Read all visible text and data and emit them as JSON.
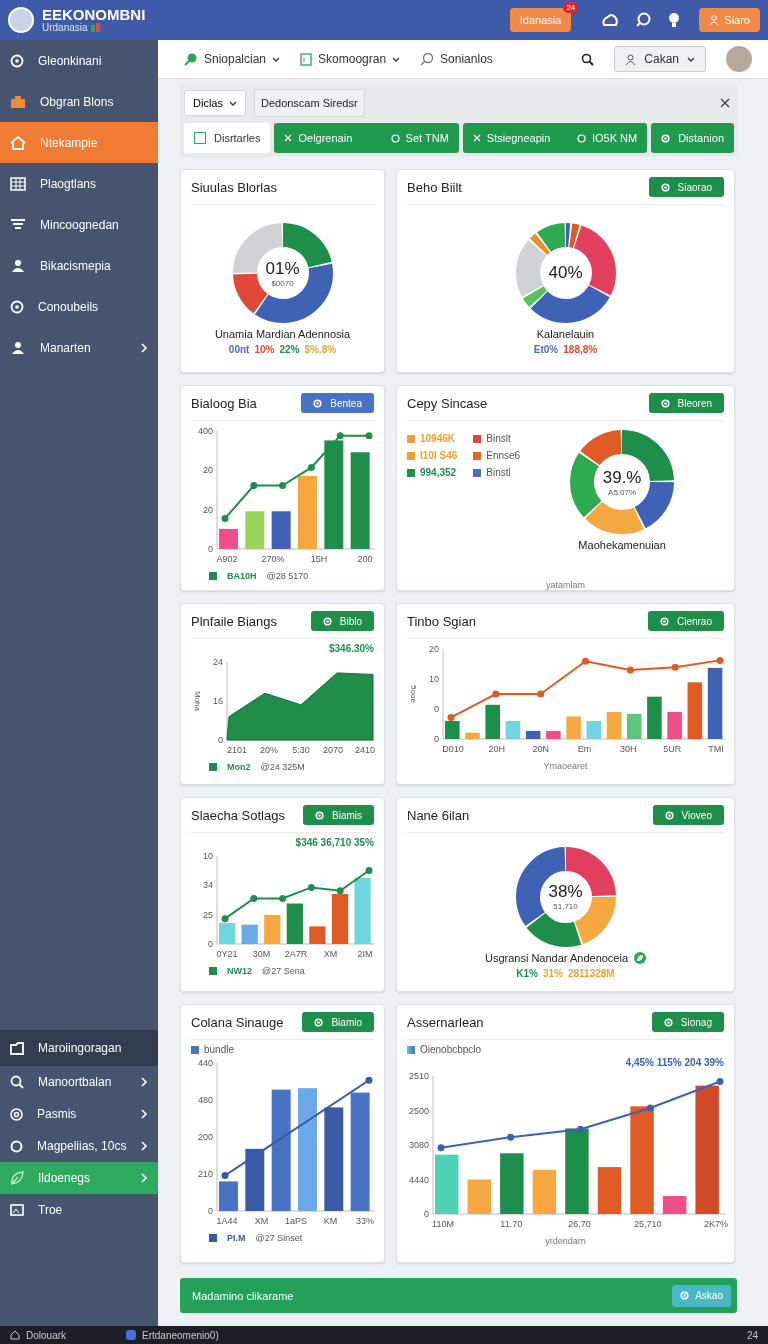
{
  "header": {
    "brand": "EEKONOMBNI",
    "subtitle": "Urdanasia",
    "notify": {
      "label": "Idanasia",
      "badge": "24"
    },
    "action": "Siaro"
  },
  "sidebar": {
    "items": [
      {
        "label": "Gleonkinani",
        "selected": false,
        "chevron": false
      },
      {
        "label": "Obgran Blons",
        "selected": false,
        "chevron": false
      },
      {
        "label": "Ntekampie",
        "selected": true,
        "chevron": false
      },
      {
        "label": "Plaogtlans",
        "selected": false,
        "chevron": false
      },
      {
        "label": "Mincoognedan",
        "selected": false,
        "chevron": false
      },
      {
        "label": "Bikacismepia",
        "selected": false,
        "chevron": false
      },
      {
        "label": "Conoubeils",
        "selected": false,
        "chevron": false
      },
      {
        "label": "Manarten",
        "selected": false,
        "chevron": true
      }
    ],
    "lower_items": [
      {
        "label": "Maroiingoragan",
        "kind": "group",
        "selected": false,
        "chevron": false
      },
      {
        "label": "Manoortbalan",
        "kind": "item",
        "selected": false,
        "chevron": true
      },
      {
        "label": "Pasmis",
        "kind": "item",
        "selected": false,
        "chevron": true
      },
      {
        "label": "Magpeliias, 10cs",
        "kind": "item",
        "selected": false,
        "chevron": true
      },
      {
        "label": "Ildoenegs",
        "kind": "item",
        "selected": true,
        "chevron": true
      },
      {
        "label": "Troe",
        "kind": "item",
        "selected": false,
        "chevron": false
      }
    ]
  },
  "nav": {
    "tabs": [
      {
        "label": "Sniopalcian",
        "dropdown": true
      },
      {
        "label": "Skomoogran",
        "dropdown": true
      },
      {
        "label": "Sonianlos",
        "dropdown": false
      }
    ],
    "account": "Cakan"
  },
  "filter": {
    "dropdown": "Diclas",
    "text": "Dedonscam Siredsr"
  },
  "chips": [
    {
      "label": "Disrtarles",
      "kind": "check"
    },
    {
      "label": "Oelgrenain",
      "kind": "pair",
      "value": "Set TNM"
    },
    {
      "label": "Stsiegneapin",
      "kind": "pair",
      "value": "IO5K NM"
    },
    {
      "label": "Distanion",
      "kind": "single"
    }
  ],
  "cards": [
    {
      "title": "Siuulas Blorlas",
      "kind": "donut",
      "center": "01%",
      "sub": "$0070",
      "caption": "Unamia Mardian Adennosia",
      "legend": [
        {
          "label": "00nt",
          "color": "#4a6fbf"
        },
        {
          "label": "10%",
          "color": "#e0483a"
        },
        {
          "label": "22%",
          "color": "#1e8e4a"
        },
        {
          "label": "$%.8%",
          "color": "#e8a23a"
        }
      ]
    },
    {
      "title": "Beho Biilt",
      "button": {
        "label": "Siaorao",
        "color": "#1e8e4a"
      },
      "kind": "donut",
      "center": "40%",
      "caption": "Kalanelauin",
      "legend": [
        {
          "label": "Et0%",
          "color": "#4a6fbf"
        },
        {
          "label": "188,8%",
          "color": "#e0483a"
        }
      ]
    },
    {
      "title": "Bialoog Bia",
      "button": {
        "label": "Bentea",
        "color": "#4a72c4"
      },
      "kind": "chart",
      "yticks": [
        "400",
        "20",
        "20",
        "0"
      ],
      "xticks": [
        "A902",
        "270%",
        "15H",
        "200"
      ],
      "legend": [
        "BA10H",
        "@28 5170"
      ]
    },
    {
      "title": "Cepy Sincase",
      "button": {
        "label": "Bleoren",
        "color": "#1e8e4a"
      },
      "kind": "legend-donut",
      "keys": [
        {
          "label": "10946K",
          "color": "#f0a030"
        },
        {
          "label": "Binslt",
          "color": "#e0483a"
        },
        {
          "label": "I10I S46",
          "color": "#f0a030"
        },
        {
          "label": "Ennse6",
          "color": "#e06a20"
        },
        {
          "label": "994,352",
          "color": "#1e8e4a"
        },
        {
          "label": "Binstl",
          "color": "#4a6fbf"
        }
      ],
      "center": "39.%",
      "sub": "A5.07%",
      "caption": "Maohekamenuian",
      "note": "yatamlam"
    },
    {
      "title": "Plnfaile Biangs",
      "button": {
        "label": "Biblo",
        "color": "#1e8e4a"
      },
      "kind": "chart",
      "annotation": "$346.30%",
      "ylabel": "Moha",
      "yticks": [
        "24",
        "16",
        "0"
      ],
      "xticks": [
        "2101",
        "20%",
        "5:30",
        "2070",
        "2410"
      ],
      "legend": [
        "Mon2",
        "@24 325M"
      ]
    },
    {
      "title": "Tinbo Sgian",
      "button": {
        "label": "Cienrao",
        "color": "#1e8e4a"
      },
      "kind": "chart",
      "ylabel": "5ooe",
      "yticks": [
        "20",
        "10",
        "0",
        "0"
      ],
      "xticks": [
        "D010",
        "20H",
        "20N",
        "Em",
        "30H",
        "5UR",
        "TMI"
      ],
      "xlabel": "Ymaoearet"
    },
    {
      "title": "Slaecha Sotlags",
      "button": {
        "label": "Biamis",
        "color": "#1e8e4a"
      },
      "kind": "chart",
      "annotation": "$346 36,710 35%",
      "yticks": [
        "10",
        "34",
        "25",
        "0"
      ],
      "xticks": [
        "0Y21",
        "30M",
        "2A7R",
        "XM",
        "2IM"
      ],
      "legend": [
        "NW12",
        "@27 Sena"
      ]
    },
    {
      "title": "Nane 6ilan",
      "button": {
        "label": "Vioveo",
        "color": "#1e8e4a"
      },
      "kind": "donut",
      "center": "38%",
      "sub": "51,710",
      "caption": "Usgransi Nandar Andenoceia",
      "legend": [
        {
          "label": "K1%",
          "color": "#1e8e4a"
        },
        {
          "label": "31%",
          "color": "#e8a23a"
        },
        {
          "label": "2811328M",
          "color": "#e8a23a"
        }
      ]
    },
    {
      "title": "Colana Sinauge",
      "button": {
        "label": "Biamio",
        "color": "#1e8e4a"
      },
      "kind": "chart",
      "topkey": "bundle",
      "yticks": [
        "440",
        "480",
        "200",
        "210",
        "0"
      ],
      "xticks": [
        "1A44",
        "XM",
        "1aPS",
        "KM",
        "33%"
      ],
      "legend": [
        "PI.M",
        "@27 Sinset"
      ]
    },
    {
      "title": "Assernarlean",
      "button": {
        "label": "Sionag",
        "color": "#1e8e4a"
      },
      "kind": "chart",
      "topkey": "Oienobcbpclo",
      "annotation": "4,45% 115% 204 39%",
      "yticks": [
        "2510",
        "2500",
        "3080",
        "4440",
        "0"
      ],
      "xticks": [
        "110M",
        "11.70",
        "26,70",
        "25,710",
        "2K7%"
      ],
      "xlabel": "yrdendarn"
    }
  ],
  "banner": {
    "text": "Madamino clikarame",
    "button": "Askao"
  },
  "taskbar": {
    "start": "Dolouark",
    "app": "Ertdaneomenio0)",
    "tray": "24"
  }
}
